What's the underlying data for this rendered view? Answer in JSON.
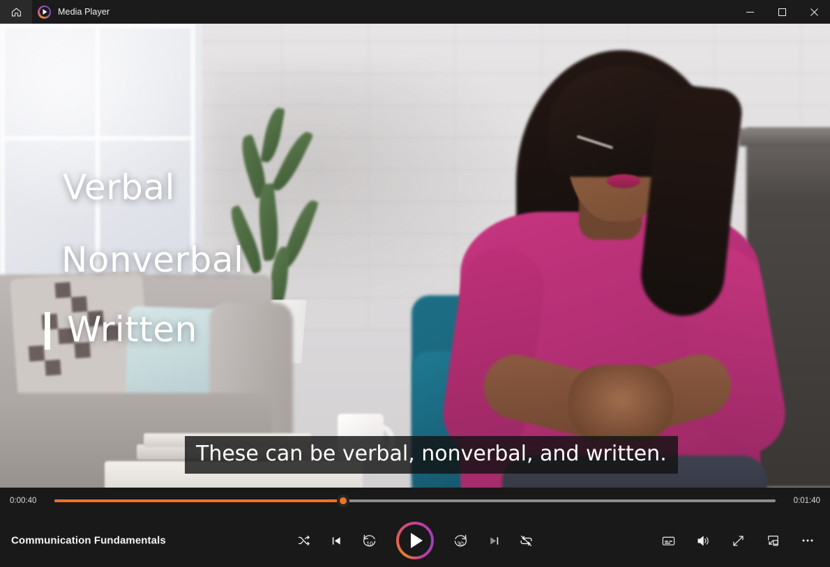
{
  "window": {
    "app_title": "Media Player",
    "home_icon": "home-icon",
    "brand_icon": "media-player-logo-icon",
    "minimize_label": "Minimize",
    "maximize_label": "Maximize",
    "close_label": "Close"
  },
  "video": {
    "overlay_words": [
      "Verbal",
      "Nonverbal",
      "Written"
    ],
    "caption_text": "These can be verbal, nonverbal, and written."
  },
  "player": {
    "track_title": "Communication Fundamentals",
    "current_time": "0:00:40",
    "total_time": "0:01:40",
    "progress_percent": 40,
    "accent_color": "#f07227",
    "track_color": "#8c8c8c"
  },
  "controls": {
    "shuffle_label": "Shuffle",
    "previous_label": "Previous",
    "rewind_label": "Rewind 10 seconds",
    "rewind_value": "10",
    "play_label": "Play",
    "forward_label": "Forward 30 seconds",
    "forward_value": "30",
    "next_label": "Next",
    "repeat_label": "Repeat off"
  },
  "right_controls": {
    "captions_label": "Subtitles/CC",
    "volume_label": "Volume",
    "fullscreen_label": "Full screen",
    "miniplayer_label": "Mini player",
    "more_label": "See more"
  }
}
